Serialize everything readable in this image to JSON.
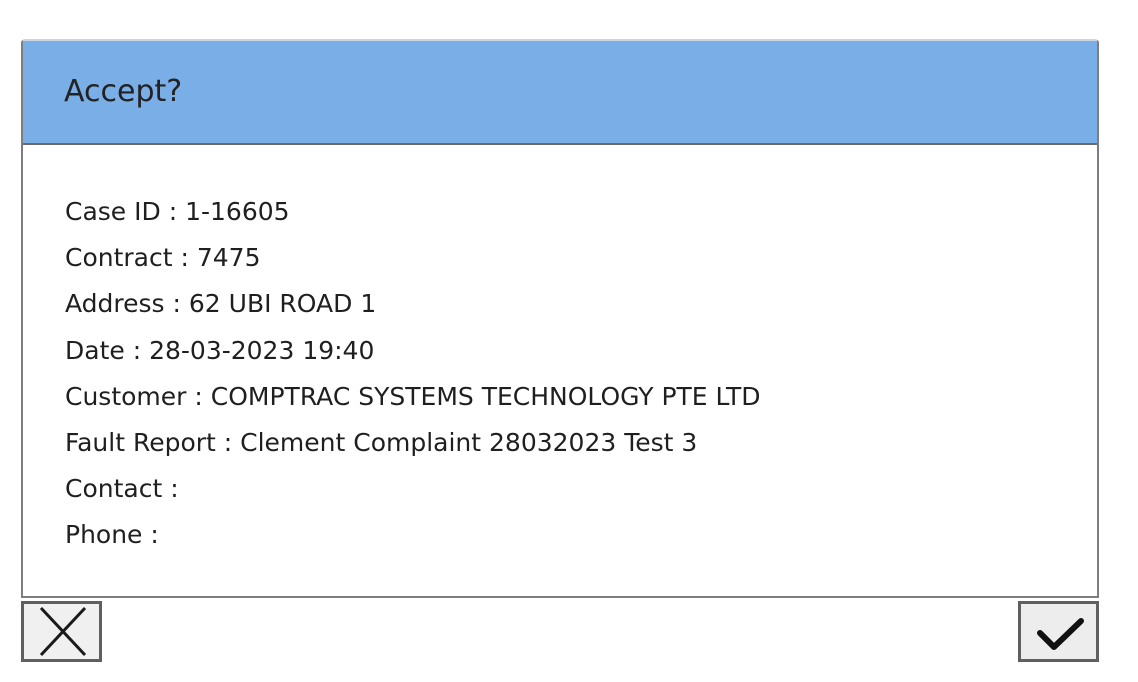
{
  "dialog": {
    "title": "Accept?",
    "fields": [
      {
        "label": "Case ID :",
        "value": "1-16605"
      },
      {
        "label": "Contract :",
        "value": "7475"
      },
      {
        "label": "Address :",
        "value": "62 UBI ROAD 1"
      },
      {
        "label": "Date :",
        "value": "28-03-2023 19:40"
      },
      {
        "label": "Customer :",
        "value": "COMPTRAC SYSTEMS TECHNOLOGY PTE LTD"
      },
      {
        "label": "Fault Report :",
        "value": "Clement Complaint 28032023 Test 3"
      },
      {
        "label": "Contact :",
        "value": ""
      },
      {
        "label": "Phone :",
        "value": ""
      }
    ]
  },
  "buttons": {
    "cancel_icon": "close-x-icon",
    "accept_icon": "checkmark-icon"
  },
  "colors": {
    "header_bg": "#7aaee6",
    "border": "#6a6a6a"
  }
}
